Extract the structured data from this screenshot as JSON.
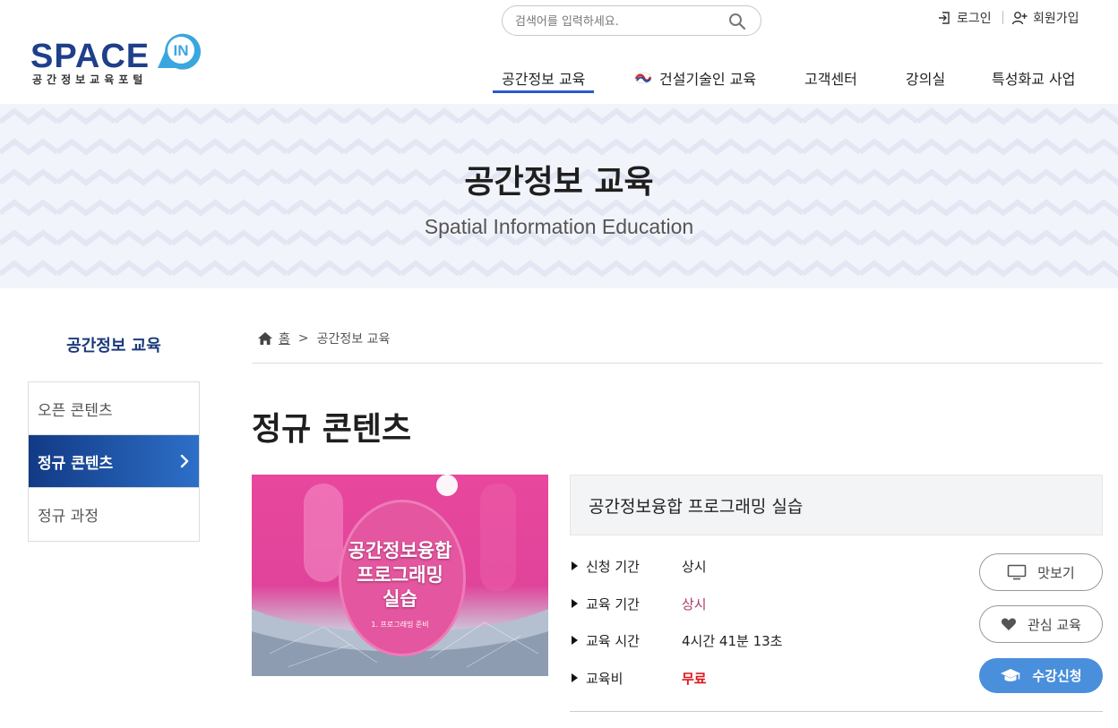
{
  "header": {
    "logo_text": "SPACE",
    "logo_badge": "IN",
    "logo_sub": "공간정보교육포털",
    "search": {
      "placeholder": "검색어를 입력하세요."
    },
    "util": {
      "login": "로그인",
      "join": "회원가입"
    },
    "nav": [
      {
        "label": "공간정보 교육",
        "active": true
      },
      {
        "label": "건설기술인 교육"
      },
      {
        "label": "고객센터"
      },
      {
        "label": "강의실"
      },
      {
        "label": "특성화교 사업"
      }
    ]
  },
  "banner": {
    "title": "공간정보 교육",
    "subtitle": "Spatial Information Education"
  },
  "sidebar": {
    "title": "공간정보 교육",
    "items": [
      {
        "label": "오픈 콘텐츠"
      },
      {
        "label": "정규 콘텐츠",
        "active": true
      },
      {
        "label": "정규 과정"
      }
    ]
  },
  "breadcrumb": {
    "home": "홈",
    "current": "공간정보 교육"
  },
  "page_title": "정규 콘텐츠",
  "course": {
    "thumbnail": {
      "title_lines": [
        "공간정보융합",
        "프로그래밍",
        "실습"
      ],
      "subtitle": "1. 프로그래밍 준비"
    },
    "name": "공간정보융합 프로그래밍 실습",
    "info": [
      {
        "label": "신청 기간",
        "value": "상시"
      },
      {
        "label": "교육 기간",
        "value": "상시"
      },
      {
        "label": "교육 시간",
        "value": "4시간 41분 13초"
      },
      {
        "label": "교육비",
        "value": "무료"
      }
    ],
    "buttons": {
      "preview": "맛보기",
      "like": "관심 교육",
      "apply": "수강신청"
    }
  },
  "colors": {
    "brand": "#1f3f8a",
    "accent": "#2a5bc7",
    "apply_button": "#4a8fdc",
    "price": "#e0141b"
  }
}
